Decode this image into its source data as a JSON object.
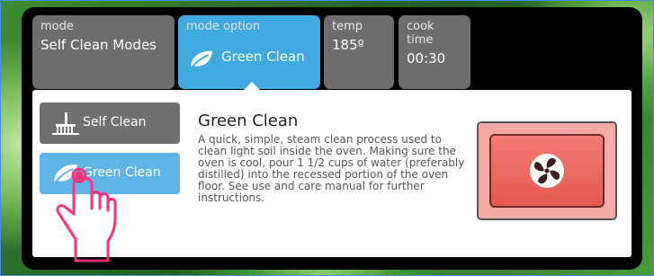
{
  "tabs": {
    "mode": {
      "label": "mode",
      "value": "Self Clean Modes"
    },
    "mode_option": {
      "label": "mode option",
      "value": "Green Clean"
    },
    "temp": {
      "label": "temp",
      "value": "185º"
    },
    "cook_time": {
      "label": "cook time",
      "value": "00:30"
    }
  },
  "options": [
    {
      "label": "Self Clean",
      "icon": "broom-icon",
      "selected": false
    },
    {
      "label": "Green Clean",
      "icon": "leaf-icon",
      "selected": true
    }
  ],
  "detail": {
    "title": "Green Clean",
    "description": "A quick, simple, steam clean process used to clean light soil inside the oven. Making sure the oven is cool, pour 1 1/2 cups of water (preferably distilled) into the recessed portion of the oven floor. See use and care manual for further instructions."
  },
  "start_button": {
    "icon": "fan-icon"
  },
  "gesture": {
    "icon": "tap-hand-icon"
  },
  "colors": {
    "accent": "#3fa9e0",
    "selected_option": "#5fb4e6",
    "tab": "#6d6d6d",
    "start_button": "#e5594f",
    "hand": "#ff2f7d"
  }
}
